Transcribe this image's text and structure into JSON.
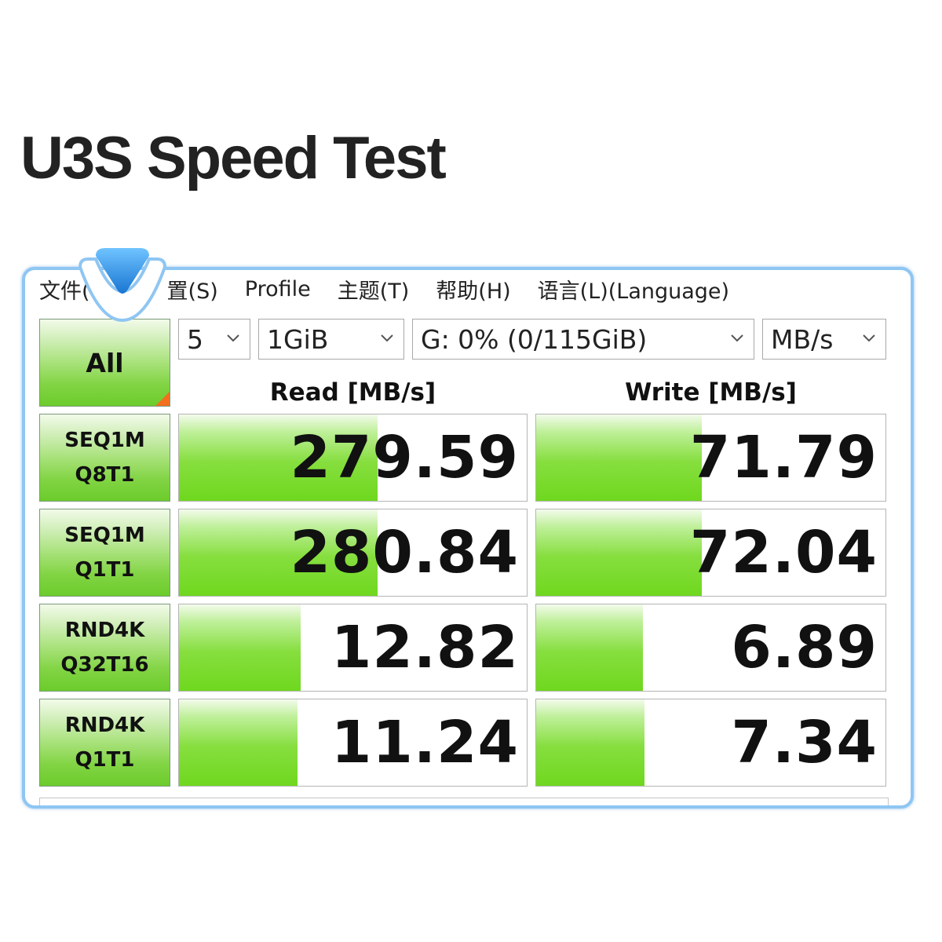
{
  "heading": "U3S Speed Test",
  "menu": {
    "file": "文件(",
    "settings": "置(S)",
    "profile": "Profile",
    "theme": "主题(T)",
    "help": "帮助(H)",
    "language": "语言(L)(Language)"
  },
  "all_button": "All",
  "selects": {
    "count": "5",
    "size": "1GiB",
    "drive": "G: 0% (0/115GiB)",
    "unit": "MB/s"
  },
  "columns": {
    "read": "Read [MB/s]",
    "write": "Write [MB/s]"
  },
  "tests": [
    {
      "line1": "SEQ1M",
      "line2": "Q8T1",
      "read": "279.59",
      "write": "71.79",
      "read_fill": 0.57,
      "write_fill": 0.475
    },
    {
      "line1": "SEQ1M",
      "line2": "Q1T1",
      "read": "280.84",
      "write": "72.04",
      "read_fill": 0.57,
      "write_fill": 0.475
    },
    {
      "line1": "RND4K",
      "line2": "Q32T16",
      "read": "12.82",
      "write": "6.89",
      "read_fill": 0.35,
      "write_fill": 0.305
    },
    {
      "line1": "RND4K",
      "line2": "Q1T1",
      "read": "11.24",
      "write": "7.34",
      "read_fill": 0.34,
      "write_fill": 0.31
    }
  ],
  "colors": {
    "accent_green": "#6fd81e",
    "frame_blue": "#8fc6f2",
    "pointer_blue": "#1e88e5",
    "corner_orange": "#f26f1e"
  },
  "icons": {
    "pointer": "location-pointer-icon",
    "dropdown": "chevron-down-icon"
  }
}
